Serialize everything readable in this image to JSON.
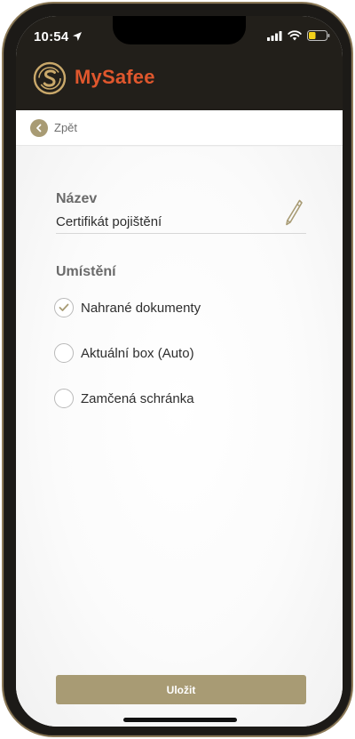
{
  "status_bar": {
    "time": "10:54",
    "battery_color": "#f3d11a"
  },
  "header": {
    "app_name": "MySafee",
    "brand_color": "#e0572d",
    "logo_color": "#c9a86a"
  },
  "nav": {
    "back_label": "Zpět"
  },
  "form": {
    "name_label": "Název",
    "name_value": "Certifikát pojištění",
    "location_label": "Umístění",
    "options": [
      {
        "label": "Nahrané dokumenty",
        "selected": true
      },
      {
        "label": "Aktuální box (Auto)",
        "selected": false
      },
      {
        "label": "Zamčená schránka",
        "selected": false
      }
    ],
    "save_label": "Uložit"
  },
  "colors": {
    "accent": "#a89b74",
    "dark_header": "#221f1a"
  }
}
